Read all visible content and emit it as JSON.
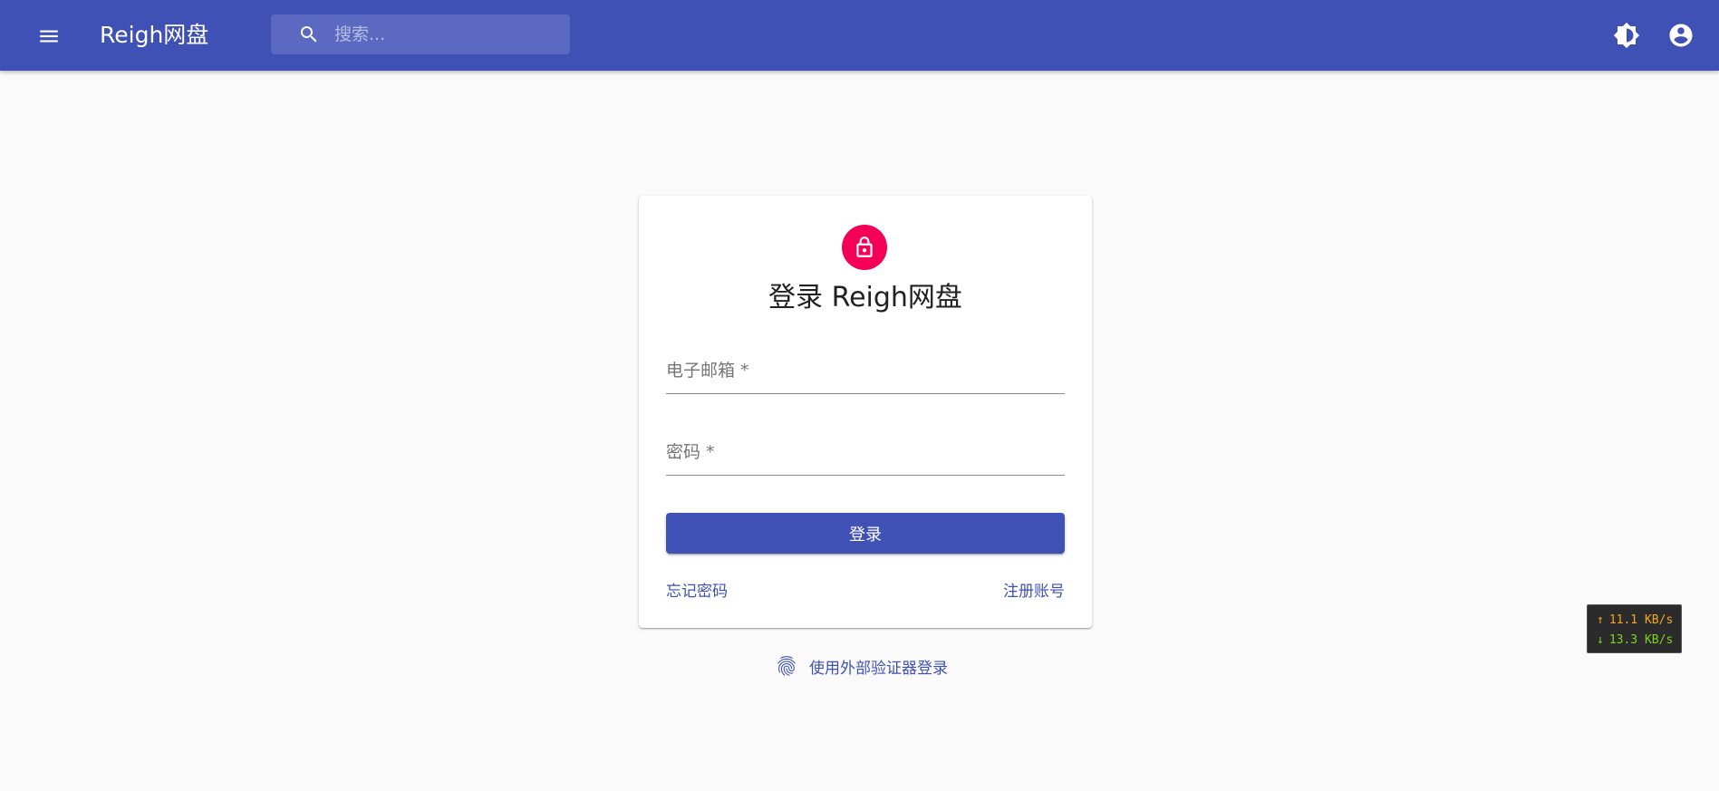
{
  "appbar": {
    "title": "Reigh网盘",
    "search_placeholder": "搜索...",
    "icons": [
      "menu-icon",
      "search-icon",
      "brightness-icon",
      "account-circle-icon"
    ],
    "color": "#3f51b5"
  },
  "login": {
    "title": "登录 Reigh网盘",
    "email_label": "电子邮箱 *",
    "password_label": "密码 *",
    "submit_label": "登录",
    "forgot_password": "忘记密码",
    "register": "注册账号",
    "external_auth": "使用外部验证器登录",
    "avatar_color": "#f50057"
  },
  "netspeed": {
    "upload": "11.1 KB/s",
    "download": "13.3 KB/s"
  }
}
